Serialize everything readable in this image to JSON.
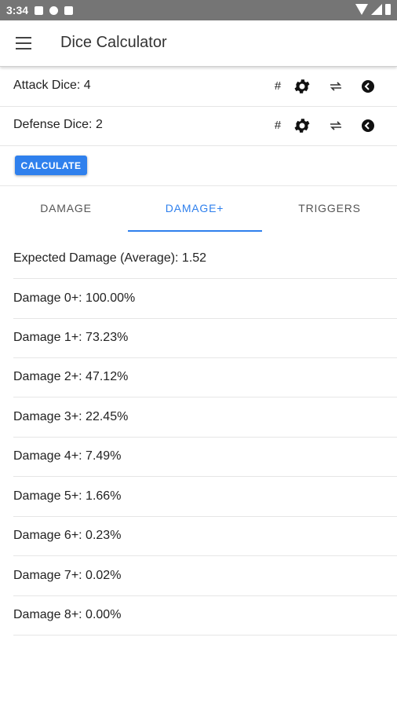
{
  "status_bar": {
    "time": "3:34"
  },
  "app_bar": {
    "title": "Dice Calculator"
  },
  "dice": [
    {
      "label": "Attack Dice: 4",
      "hash_label": "#"
    },
    {
      "label": "Defense Dice: 2",
      "hash_label": "#"
    }
  ],
  "calculate_button": {
    "label": "CALCULATE"
  },
  "tabs": [
    {
      "label": "DAMAGE",
      "active": false
    },
    {
      "label": "DAMAGE+",
      "active": true
    },
    {
      "label": "TRIGGERS",
      "active": false
    }
  ],
  "results": [
    "Expected Damage (Average): 1.52",
    "Damage 0+: 100.00%",
    "Damage 1+: 73.23%",
    "Damage 2+: 47.12%",
    "Damage 3+: 22.45%",
    "Damage 4+: 7.49%",
    "Damage 5+: 1.66%",
    "Damage 6+: 0.23%",
    "Damage 7+: 0.02%",
    "Damage 8+: 0.00%"
  ],
  "colors": {
    "accent": "#2f80ed",
    "status_bar": "#757575"
  }
}
